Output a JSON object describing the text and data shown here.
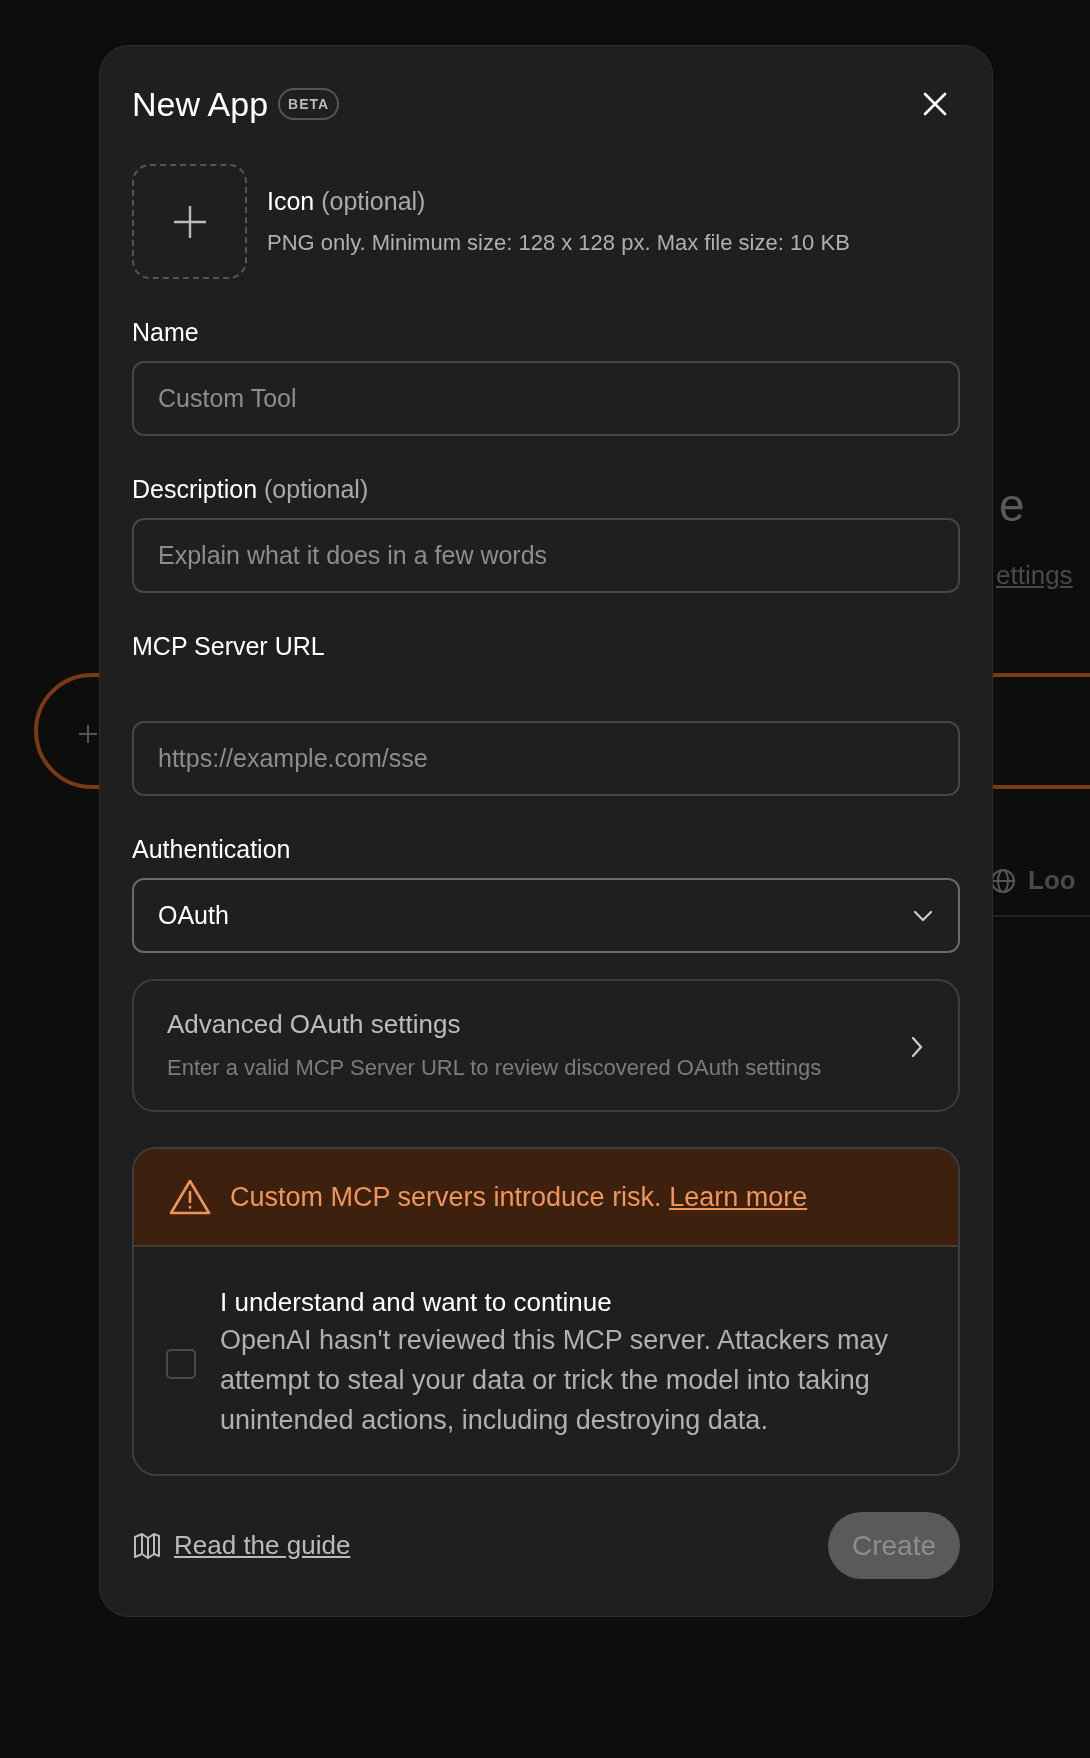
{
  "background": {
    "heading_fragment": "e",
    "link_fragment": "ettings",
    "tool_fragment": "Loo"
  },
  "dialog": {
    "title": "New App",
    "badge": "BETA",
    "icon_upload": {
      "label": "Icon",
      "hint": "(optional)",
      "requirements": "PNG only. Minimum size: 128 x 128 px. Max file size: 10 KB"
    },
    "fields": [
      {
        "kind": "text",
        "label": "Name",
        "placeholder": "Custom Tool"
      },
      {
        "kind": "text",
        "label": "Description",
        "hint": "(optional)",
        "placeholder": "Explain what it does in a few words"
      },
      {
        "kind": "url",
        "label": "MCP Server URL",
        "placeholder": "https://example.com/sse"
      },
      {
        "kind": "select",
        "label": "Authentication",
        "value": "OAuth"
      }
    ],
    "advanced": {
      "title": "Advanced OAuth settings",
      "description": "Enter a valid MCP Server URL to review discovered OAuth settings"
    },
    "warning": {
      "message": "Custom MCP servers introduce risk.",
      "link": "Learn more"
    },
    "consent": {
      "checked": false,
      "title": "I understand and want to continue",
      "description": "OpenAI hasn't reviewed this MCP server. Attackers may attempt to steal your data or trick the model into taking unintended actions, including destroying data."
    },
    "guide_link": "Read the guide",
    "create_button": {
      "label": "Create",
      "disabled": true
    }
  }
}
